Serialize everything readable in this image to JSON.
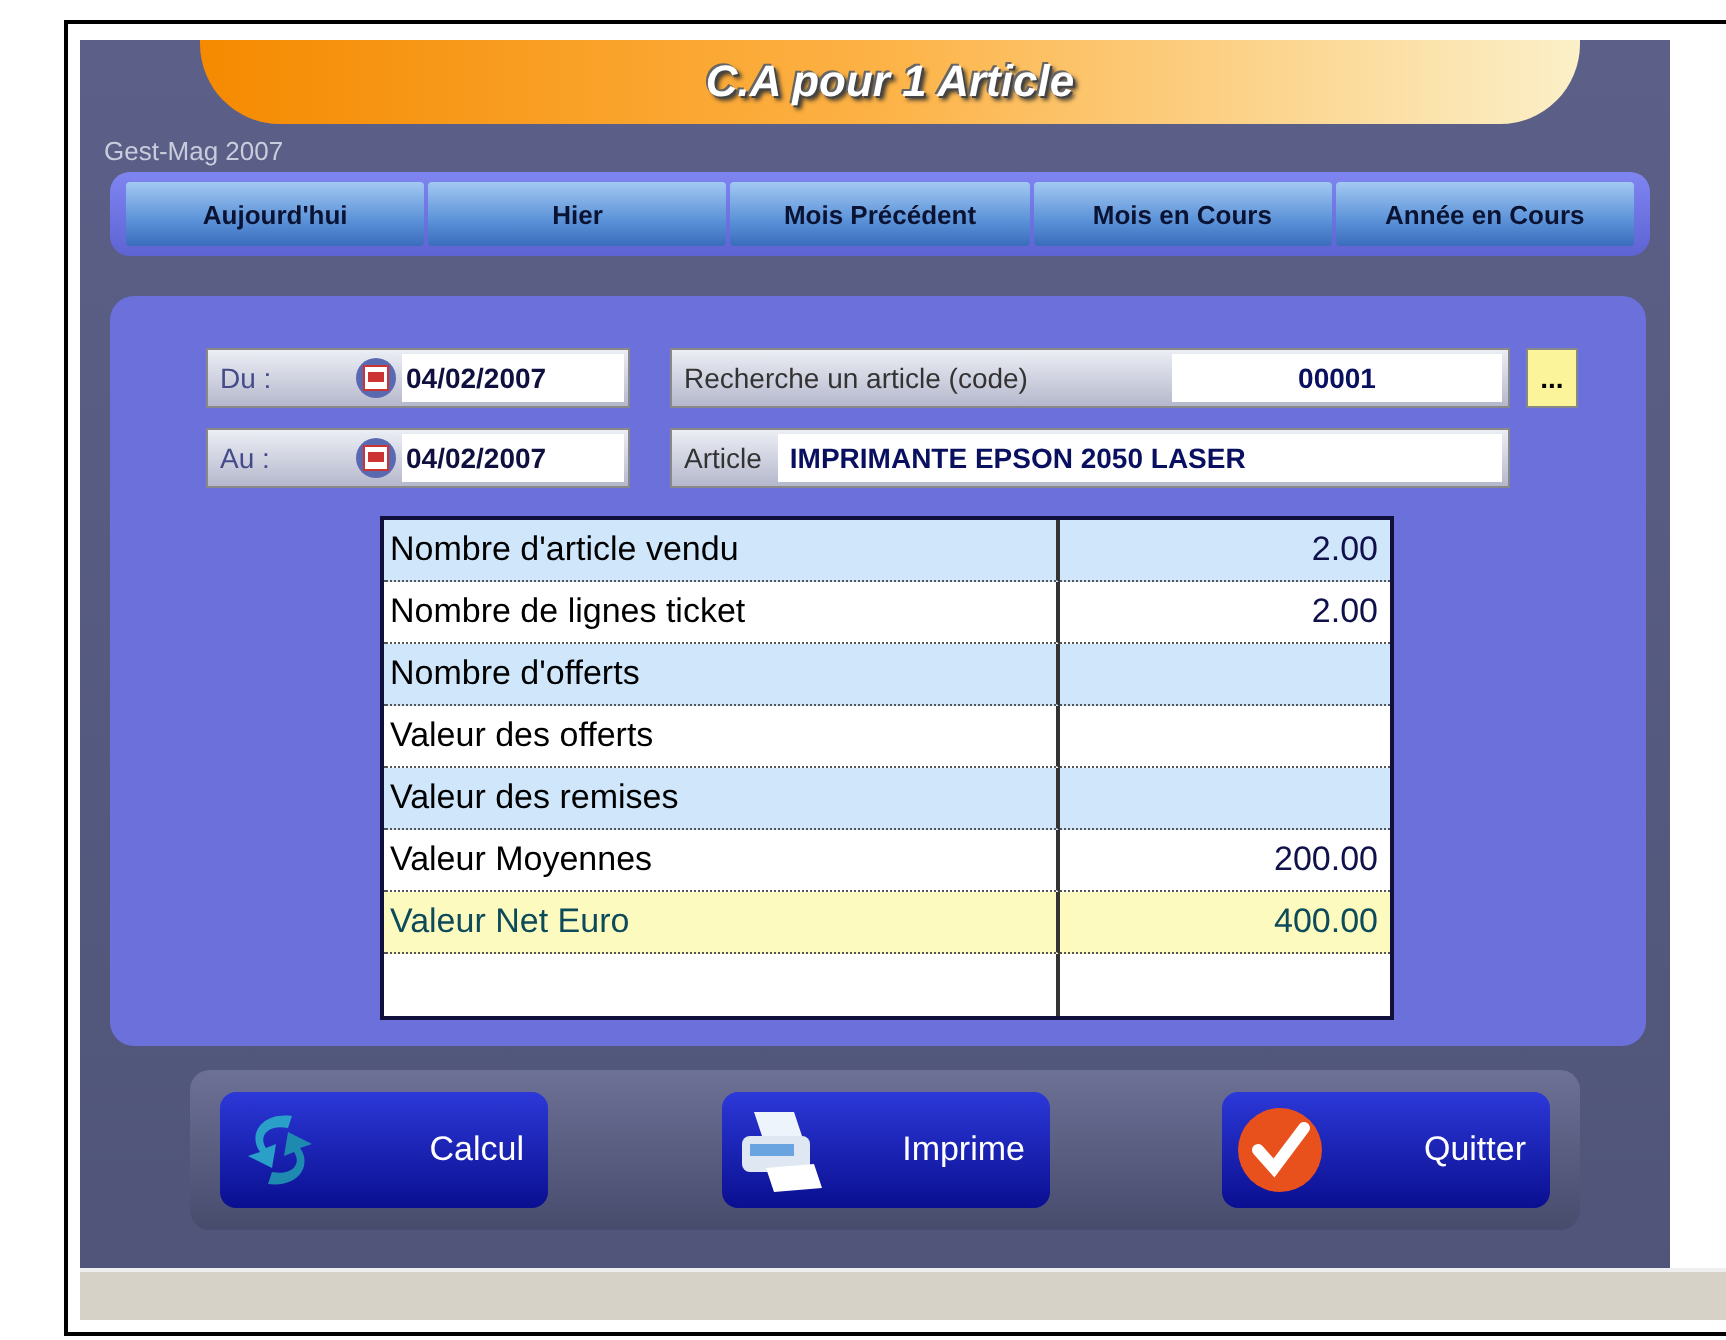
{
  "window": {
    "title": "C.A pour 1 Article",
    "app_name": "Gest-Mag 2007"
  },
  "period_tabs": [
    {
      "label": "Aujourd'hui"
    },
    {
      "label": "Hier"
    },
    {
      "label": "Mois Précédent"
    },
    {
      "label": "Mois en Cours"
    },
    {
      "label": "Année en Cours"
    }
  ],
  "date_from": {
    "label": "Du :",
    "value": "04/02/2007"
  },
  "date_to": {
    "label": "Au :",
    "value": "04/02/2007"
  },
  "search": {
    "label": "Recherche un article (code)",
    "value": "00001",
    "browse_label": "..."
  },
  "article": {
    "label": "Article",
    "value": "IMPRIMANTE EPSON 2050 LASER"
  },
  "stats": [
    {
      "label": "Nombre d'article vendu",
      "value": "2.00",
      "highlighted": false
    },
    {
      "label": "Nombre de lignes ticket",
      "value": "2.00",
      "highlighted": false
    },
    {
      "label": "Nombre d'offerts",
      "highlighted": false
    },
    {
      "label": "Valeur des offerts",
      "highlighted": false
    },
    {
      "label": "Valeur des remises",
      "highlighted": false
    },
    {
      "label": "Valeur Moyennes",
      "value": "200.00",
      "highlighted": false
    },
    {
      "label": "Valeur Net Euro",
      "value": "400.00",
      "highlighted": true
    }
  ],
  "actions": [
    {
      "label": "Calcul",
      "kind": "refresh"
    },
    {
      "label": "Imprime",
      "kind": "print"
    },
    {
      "label": "Quitter",
      "kind": "quit"
    }
  ]
}
